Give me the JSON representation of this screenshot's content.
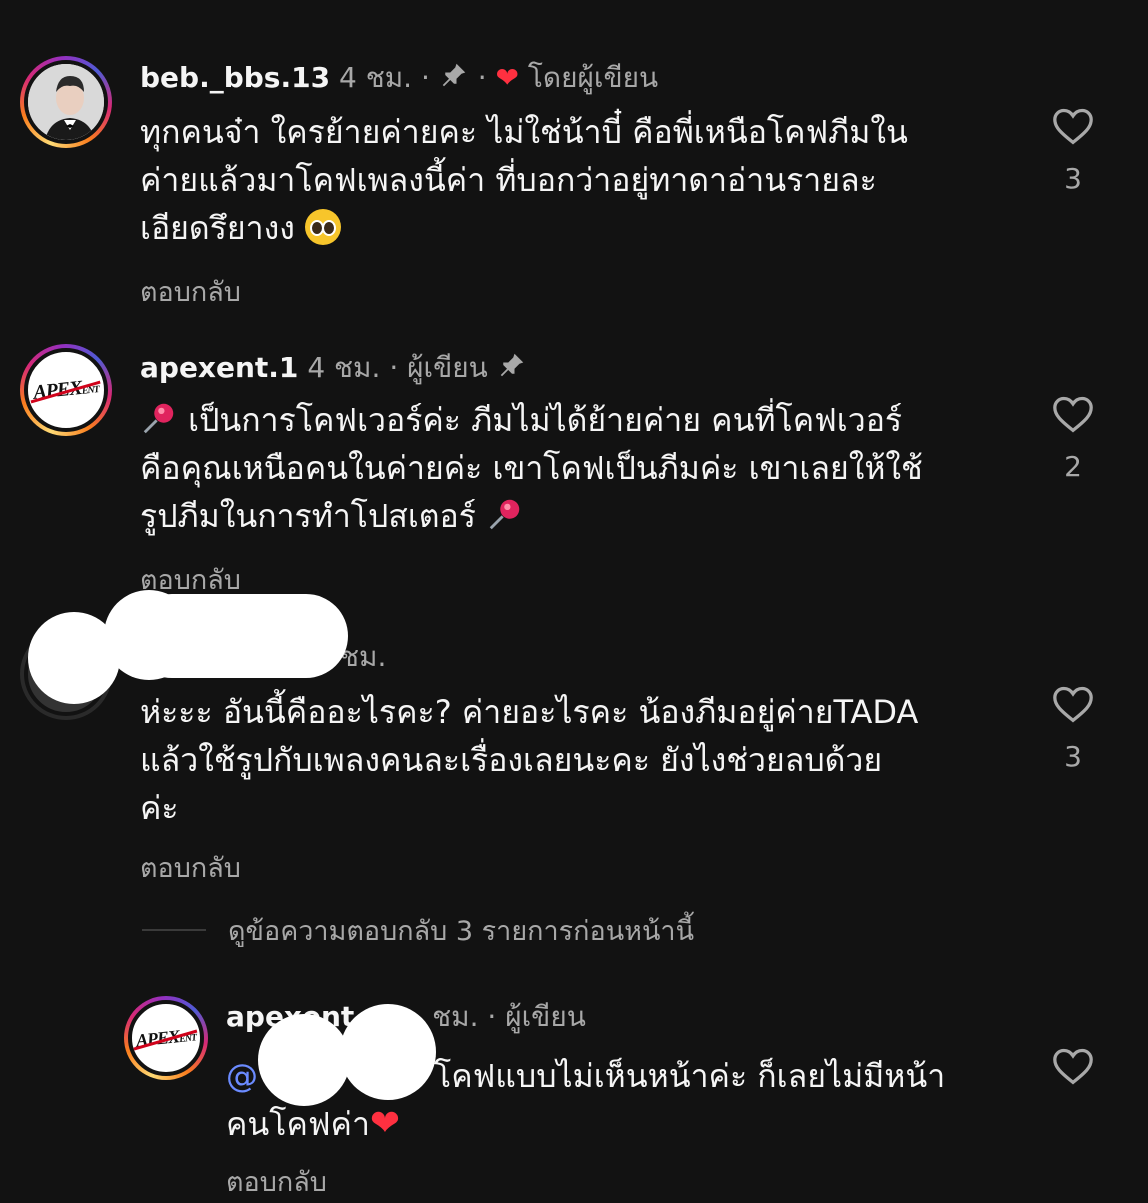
{
  "comments": [
    {
      "username": "beb._bbs.13",
      "time": "4 ชม.",
      "by_author_label": "โดยผู้เขียน",
      "text_lines": [
        "ทุกคนจ๋า ใครย้ายค่ายคะ ไม่ใช่น้าบี๋ คือพี่เหนือโคฟภีมใน",
        "ค่ายแล้วมาโคฟเพลงนี้ค่า ที่บอกว่าอยู่ทาดาอ่านรายละ",
        "เอียดรึยางง"
      ],
      "reply_label": "ตอบกลับ",
      "like_count": "3"
    },
    {
      "username": "apexent.1",
      "time": "4 ชม.",
      "author_label": "ผู้เขียน",
      "text_lines": [
        "เป็นการโคฟเวอร์ค่ะ ภีมไม่ได้ย้ายค่าย คนที่โคฟเวอร์",
        "คือคุณเหนือคนในค่ายค่ะ เขาโคฟเป็นภีมค่ะ เขาเลยให้ใช้",
        "รูปภีมในการทำโปสเตอร์"
      ],
      "reply_label": "ตอบกลับ",
      "like_count": "2"
    },
    {
      "time": "ชม.",
      "text_lines": [
        "ห่ะะะ อันนี้คืออะไรคะ? ค่ายอะไรคะ น้องภีมอยู่ค่ายTADA",
        "แล้วใช้รูปกับเพลงคนละเรื่องเลยนะคะ ยังไงช่วยลบด้วย",
        "ค่ะ"
      ],
      "reply_label": "ตอบกลับ",
      "like_count": "3"
    }
  ],
  "view_replies_label": "ดูข้อความตอบกลับ 3 รายการก่อนหน้านี้",
  "reply": {
    "username": "apexent",
    "time": "ชม.",
    "author_label": "ผู้เขียน",
    "mention": "@",
    "text_line1": "โคฟแบบไม่เห็นหน้าค่ะ ก็เลยไม่มีหน้า",
    "text_line2": "คนโคฟค่า",
    "reply_label": "ตอบกลับ"
  },
  "colors": {
    "background": "#121212",
    "text": "#f5f5f5",
    "muted": "#a8a8a8",
    "heart_red": "#ff3040",
    "mention": "#6b8bff"
  }
}
